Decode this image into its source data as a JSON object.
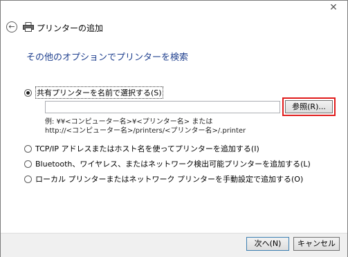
{
  "window": {
    "title": "プリンターの追加",
    "close_label": "✕"
  },
  "header": {
    "back_icon": "back-arrow-icon",
    "printer_icon": "printer-icon"
  },
  "main": {
    "headline": "その他のオプションでプリンターを検索",
    "options": [
      {
        "label": "共有プリンターを名前で選択する(S)",
        "checked": true
      },
      {
        "label": "TCP/IP アドレスまたはホスト名を使ってプリンターを追加する(I)",
        "checked": false
      },
      {
        "label": "Bluetooth、ワイヤレス、またはネットワーク検出可能プリンターを追加する(L)",
        "checked": false
      },
      {
        "label": "ローカル プリンターまたはネットワーク プリンターを手動設定で追加する(O)",
        "checked": false
      }
    ],
    "path_input": {
      "value": "",
      "placeholder": ""
    },
    "browse_label": "参照(R)...",
    "example_line1": "例: ¥¥<コンピューター名>¥<プリンター名> または",
    "example_line2": "http://<コンピューター名>/printers/<プリンター名>/.printer",
    "highlight_color": "#e01a1a"
  },
  "footer": {
    "next_label": "次へ(N)",
    "cancel_label": "キャンセル"
  }
}
